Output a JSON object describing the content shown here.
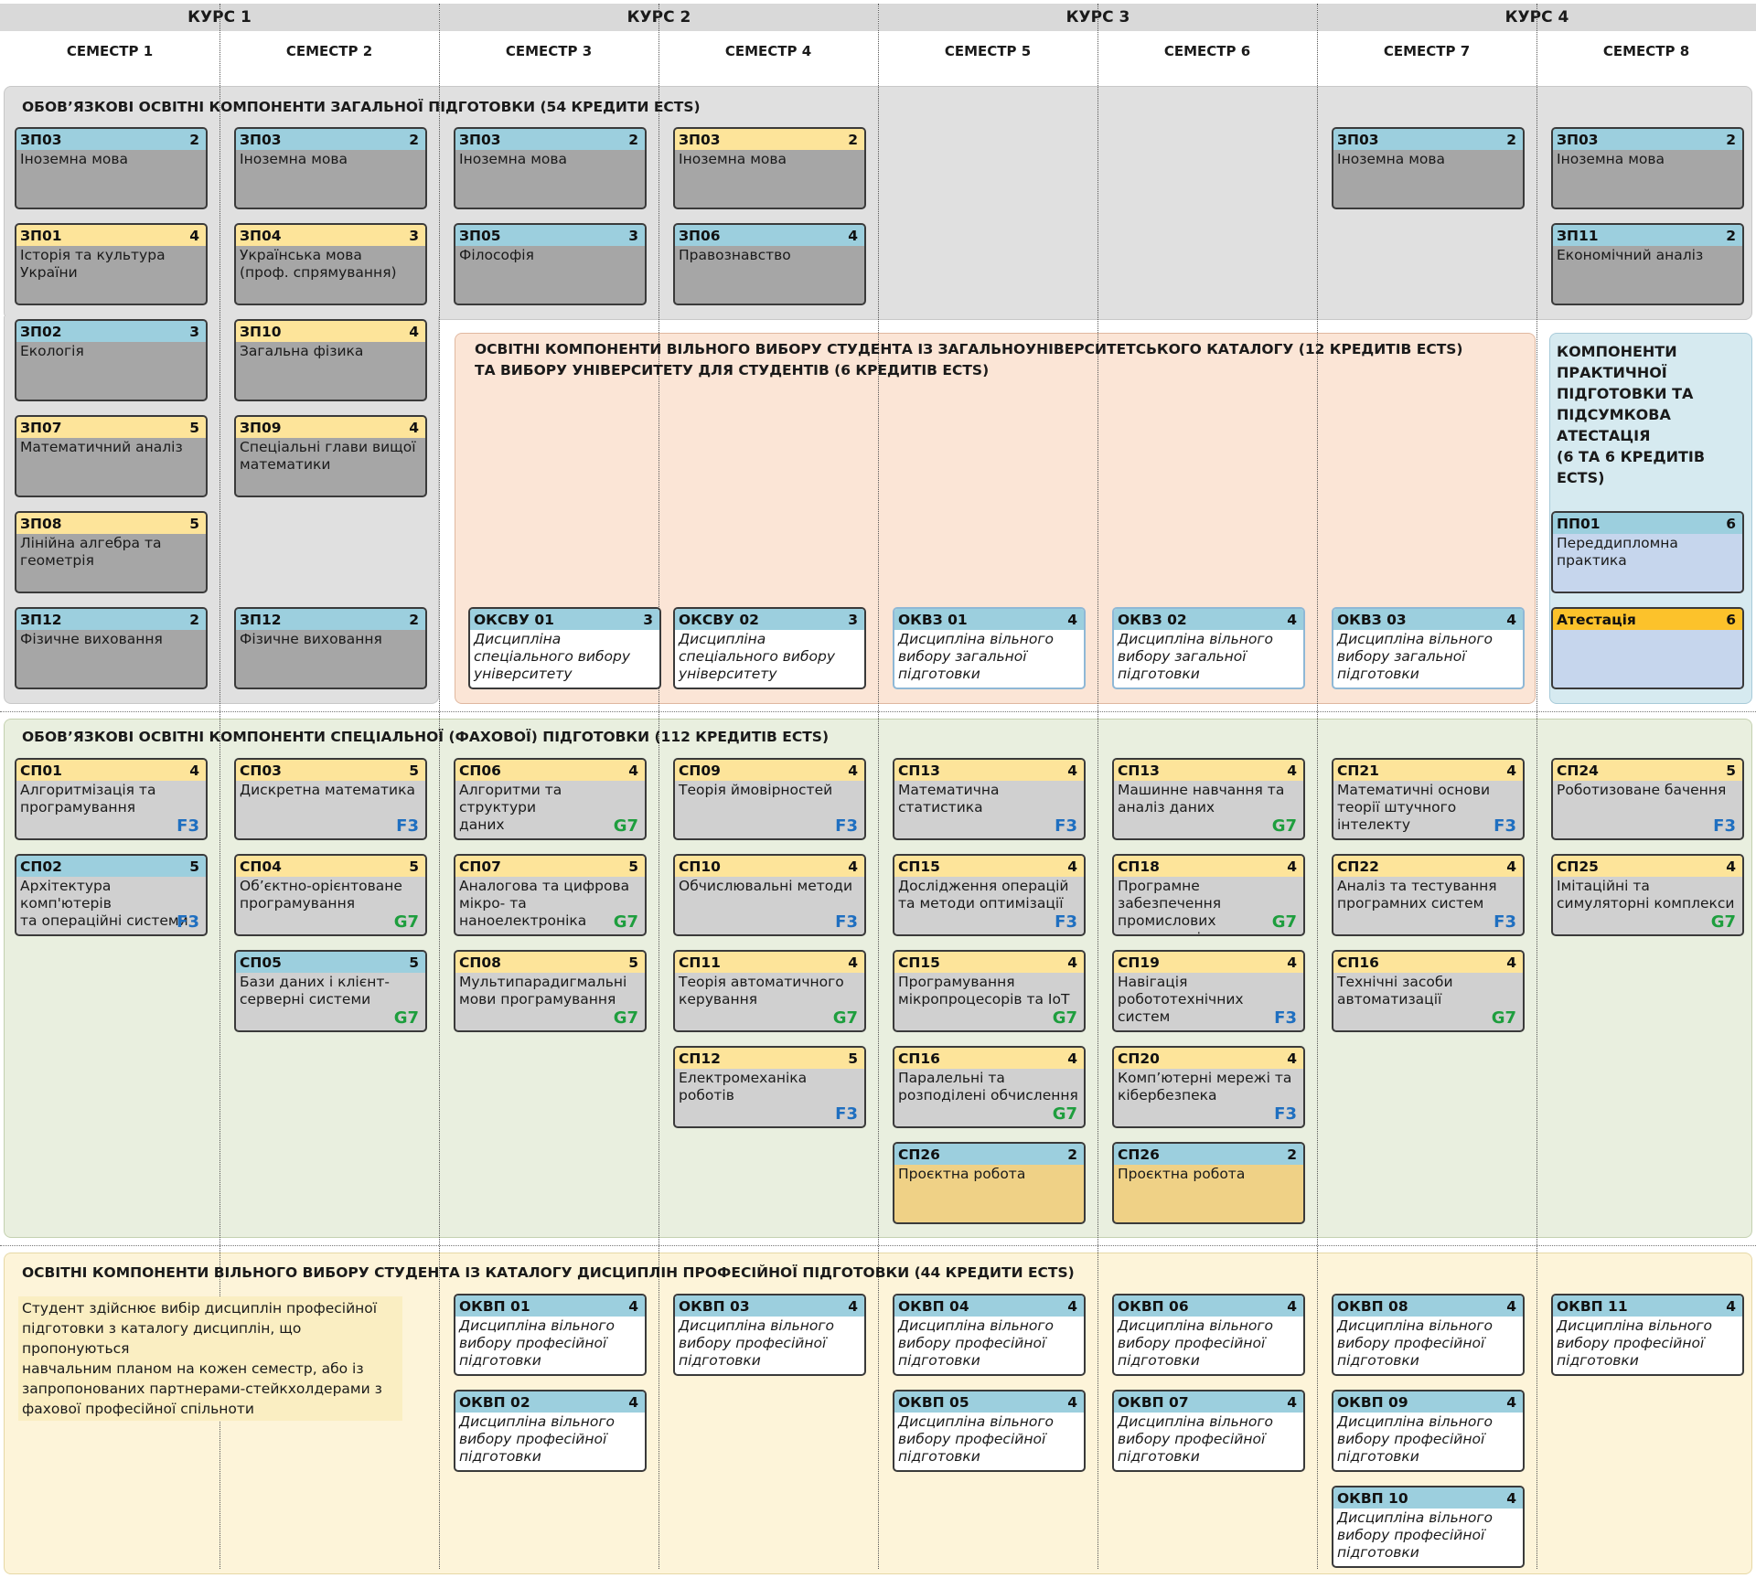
{
  "header": {
    "courses": [
      "КУРС 1",
      "КУРС 2",
      "КУРС 3",
      "КУРС 4"
    ],
    "semesters": [
      "СЕМЕСТР 1",
      "СЕМЕСТР 2",
      "СЕМЕСТР 3",
      "СЕМЕСТР 4",
      "СЕМЕСТР 5",
      "СЕМЕСТР 6",
      "СЕМЕСТР 7",
      "СЕМЕСТР 8"
    ]
  },
  "sections": {
    "general": {
      "title": "ОБОВ’ЯЗКОВІ ОСВІТНІ КОМПОНЕНТИ ЗАГАЛЬНОЇ ПІДГОТОВКИ (54 КРЕДИТИ ECTS)"
    },
    "free_choice": {
      "title_line1": "ОСВІТНІ КОМПОНЕНТИ ВІЛЬНОГО ВИБОРУ СТУДЕНТА ІЗ ЗАГАЛЬНОУНІВЕРСИТЕТСЬКОГО КАТАЛОГУ (12 КРЕДИТІВ ECTS)",
      "title_line2": "ТА ВИБОРУ УНІВЕРСИТЕТУ ДЛЯ СТУДЕНТІВ (6 КРЕДИТІВ ECTS)"
    },
    "practice": {
      "title_lines": [
        "КОМПОНЕНТИ",
        "ПРАКТИЧНОЇ",
        "ПІДГОТОВКИ ТА",
        "ПІДСУМКОВА АТЕСТАЦІЯ",
        "(6 ТА 6 КРЕДИТІВ ECTS)"
      ]
    },
    "special": {
      "title": "ОБОВ’ЯЗКОВІ ОСВІТНІ КОМПОНЕНТИ СПЕЦІАЛЬНОЇ (ФАХОВОЇ) ПІДГОТОВКИ (112 КРЕДИТІВ ECTS)"
    },
    "professional": {
      "title": "ОСВІТНІ КОМПОНЕНТИ ВІЛЬНОГО ВИБОРУ СТУДЕНТА ІЗ КАТАЛОГУ ДИСЦИПЛІН ПРОФЕСІЙНОЇ ПІДГОТОВКИ (44 КРЕДИТИ ECTS)",
      "note_lines": [
        "Студент здійснює вибір дисциплін професійної",
        "підготовки з каталогу дисциплін, що пропонуються",
        "навчальним планом на кожен семестр, або із",
        "запропонованих партнерами-стейкхолдерами з",
        "фахової професійної спільноти"
      ]
    }
  },
  "cards": [
    {
      "col": 0,
      "row": 0,
      "code": "ЗП03",
      "credits": "2",
      "lines": [
        "Іноземна мова"
      ],
      "header": "blue",
      "body": "dark"
    },
    {
      "col": 1,
      "row": 0,
      "code": "ЗП03",
      "credits": "2",
      "lines": [
        "Іноземна мова"
      ],
      "header": "blue",
      "body": "dark"
    },
    {
      "col": 2,
      "row": 0,
      "code": "ЗП03",
      "credits": "2",
      "lines": [
        "Іноземна мова"
      ],
      "header": "blue",
      "body": "dark"
    },
    {
      "col": 3,
      "row": 0,
      "code": "ЗП03",
      "credits": "2",
      "lines": [
        "Іноземна мова"
      ],
      "header": "yellow",
      "body": "dark"
    },
    {
      "col": 6,
      "row": 0,
      "code": "ЗП03",
      "credits": "2",
      "lines": [
        "Іноземна мова"
      ],
      "header": "blue",
      "body": "dark"
    },
    {
      "col": 7,
      "row": 0,
      "code": "ЗП03",
      "credits": "2",
      "lines": [
        "Іноземна мова"
      ],
      "header": "blue",
      "body": "dark"
    },
    {
      "col": 0,
      "row": 1,
      "code": "ЗП01",
      "credits": "4",
      "lines": [
        "Історія та культура",
        "України"
      ],
      "header": "yellow",
      "body": "dark"
    },
    {
      "col": 1,
      "row": 1,
      "code": "ЗП04",
      "credits": "3",
      "lines": [
        "Українська мова",
        "(проф. спрямування)"
      ],
      "header": "yellow",
      "body": "dark"
    },
    {
      "col": 2,
      "row": 1,
      "code": "ЗП05",
      "credits": "3",
      "lines": [
        "Філософія"
      ],
      "header": "blue",
      "body": "dark"
    },
    {
      "col": 3,
      "row": 1,
      "code": "ЗП06",
      "credits": "4",
      "lines": [
        "Правознавство"
      ],
      "header": "blue",
      "body": "dark"
    },
    {
      "col": 7,
      "row": 1,
      "code": "ЗП11",
      "credits": "2",
      "lines": [
        "Економічний аналіз"
      ],
      "header": "blue",
      "body": "dark"
    },
    {
      "col": 0,
      "row": 2,
      "code": "ЗП02",
      "credits": "3",
      "lines": [
        "Екологія"
      ],
      "header": "blue",
      "body": "dark"
    },
    {
      "col": 1,
      "row": 2,
      "code": "ЗП10",
      "credits": "4",
      "lines": [
        "Загальна фізика"
      ],
      "header": "yellow",
      "body": "dark"
    },
    {
      "col": 0,
      "row": 3,
      "code": "ЗП07",
      "credits": "5",
      "lines": [
        "Математичний аналіз"
      ],
      "header": "yellow",
      "body": "dark"
    },
    {
      "col": 1,
      "row": 3,
      "code": "ЗП09",
      "credits": "4",
      "lines": [
        "Спеціальні глави вищої",
        "математики"
      ],
      "header": "yellow",
      "body": "dark"
    },
    {
      "col": 0,
      "row": 4,
      "code": "ЗП08",
      "credits": "5",
      "lines": [
        "Лінійна алгебра та",
        "геометрія"
      ],
      "header": "yellow",
      "body": "dark"
    },
    {
      "col": 7,
      "row": 4,
      "code": "ПП01",
      "credits": "6",
      "lines": [
        "Переддипломна",
        "практика"
      ],
      "header": "blue",
      "body": "bluebody"
    },
    {
      "col": 0,
      "row": 5,
      "code": "ЗП12",
      "credits": "2",
      "lines": [
        "Фізичне виховання"
      ],
      "header": "blue",
      "body": "dark"
    },
    {
      "col": 1,
      "row": 5,
      "code": "ЗП12",
      "credits": "2",
      "lines": [
        "Фізичне виховання"
      ],
      "header": "blue",
      "body": "dark"
    },
    {
      "col": 2,
      "row": 5,
      "code": "ОКСВУ 01",
      "credits": "3",
      "lines": [
        "Дисципліна",
        "спеціального вибору",
        "університету"
      ],
      "header": "blue",
      "body": "white",
      "italic": true,
      "inset": true
    },
    {
      "col": 3,
      "row": 5,
      "code": "ОКСВУ 02",
      "credits": "3",
      "lines": [
        "Дисципліна",
        "спеціального вибору",
        "університету"
      ],
      "header": "blue",
      "body": "white",
      "italic": true
    },
    {
      "col": 4,
      "row": 5,
      "code": "ОКВЗ 01",
      "credits": "4",
      "lines": [
        "Дисципліна вільного",
        "вибору загальної",
        "підготовки"
      ],
      "header": "blue",
      "body": "white",
      "italic": true,
      "blueborder": true
    },
    {
      "col": 5,
      "row": 5,
      "code": "ОКВЗ 02",
      "credits": "4",
      "lines": [
        "Дисципліна вільного",
        "вибору загальної",
        "підготовки"
      ],
      "header": "blue",
      "body": "white",
      "italic": true,
      "blueborder": true
    },
    {
      "col": 6,
      "row": 5,
      "code": "ОКВЗ 03",
      "credits": "4",
      "lines": [
        "Дисципліна вільного",
        "вибору загальної",
        "підготовки"
      ],
      "header": "blue",
      "body": "white",
      "italic": true,
      "blueborder": true
    },
    {
      "col": 7,
      "row": 5,
      "code": "Атестація",
      "credits": "6",
      "lines": [],
      "header": "orange",
      "body": "bluebody"
    },
    {
      "col": 0,
      "row": 6,
      "code": "СП01",
      "credits": "4",
      "lines": [
        "Алгоритмізація та",
        "програмування"
      ],
      "header": "yellow",
      "body": "light",
      "tag": "F3"
    },
    {
      "col": 1,
      "row": 6,
      "code": "СП03",
      "credits": "5",
      "lines": [
        "Дискретна математика"
      ],
      "header": "yellow",
      "body": "light",
      "tag": "F3"
    },
    {
      "col": 2,
      "row": 6,
      "code": "СП06",
      "credits": "4",
      "lines": [
        "Алгоритми та структури",
        "даних"
      ],
      "header": "yellow",
      "body": "light",
      "tag": "G7"
    },
    {
      "col": 3,
      "row": 6,
      "code": "СП09",
      "credits": "4",
      "lines": [
        "Теорія ймовірностей"
      ],
      "header": "yellow",
      "body": "light",
      "tag": "F3"
    },
    {
      "col": 4,
      "row": 6,
      "code": "СП13",
      "credits": "4",
      "lines": [
        "Математична статистика"
      ],
      "header": "yellow",
      "body": "light",
      "tag": "F3"
    },
    {
      "col": 5,
      "row": 6,
      "code": "СП13",
      "credits": "4",
      "lines": [
        "Машинне навчання та",
        "аналіз даних"
      ],
      "header": "yellow",
      "body": "light",
      "tag": "G7"
    },
    {
      "col": 6,
      "row": 6,
      "code": "СП21",
      "credits": "4",
      "lines": [
        "Математичні основи",
        "теорії штучного",
        "інтелекту"
      ],
      "header": "yellow",
      "body": "light",
      "tag": "F3"
    },
    {
      "col": 7,
      "row": 6,
      "code": "СП24",
      "credits": "5",
      "lines": [
        "Роботизоване бачення"
      ],
      "header": "yellow",
      "body": "light",
      "tag": "F3"
    },
    {
      "col": 0,
      "row": 7,
      "code": "СП02",
      "credits": "5",
      "lines": [
        "Архітектура комп'ютерів",
        "та операційні системи"
      ],
      "header": "blue",
      "body": "light",
      "tag": "F3"
    },
    {
      "col": 1,
      "row": 7,
      "code": "СП04",
      "credits": "5",
      "lines": [
        "Об’єктно-орієнтоване",
        "програмування"
      ],
      "header": "yellow",
      "body": "light",
      "tag": "G7"
    },
    {
      "col": 2,
      "row": 7,
      "code": "СП07",
      "credits": "5",
      "lines": [
        "Аналогова та цифрова",
        "мікро- та",
        "наноелектроніка"
      ],
      "header": "yellow",
      "body": "light",
      "tag": "G7"
    },
    {
      "col": 3,
      "row": 7,
      "code": "СП10",
      "credits": "4",
      "lines": [
        "Обчислювальні методи"
      ],
      "header": "yellow",
      "body": "light",
      "tag": "F3"
    },
    {
      "col": 4,
      "row": 7,
      "code": "СП15",
      "credits": "4",
      "lines": [
        "Дослідження операцій",
        "та методи оптимізації"
      ],
      "header": "yellow",
      "body": "light",
      "tag": "F3"
    },
    {
      "col": 5,
      "row": 7,
      "code": "СП18",
      "credits": "4",
      "lines": [
        "Програмне забезпечення",
        "промислових контролерів"
      ],
      "header": "yellow",
      "body": "light",
      "tag": "G7"
    },
    {
      "col": 6,
      "row": 7,
      "code": "СП22",
      "credits": "4",
      "lines": [
        "Аналіз та тестування",
        "програмних систем"
      ],
      "header": "yellow",
      "body": "light",
      "tag": "F3"
    },
    {
      "col": 7,
      "row": 7,
      "code": "СП25",
      "credits": "4",
      "lines": [
        "Імітаційні та",
        "симуляторні комплекси"
      ],
      "header": "yellow",
      "body": "light",
      "tag": "G7"
    },
    {
      "col": 1,
      "row": 8,
      "code": "СП05",
      "credits": "5",
      "lines": [
        "Бази даних і клієнт-",
        "серверні системи"
      ],
      "header": "blue",
      "body": "light",
      "tag": "G7"
    },
    {
      "col": 2,
      "row": 8,
      "code": "СП08",
      "credits": "5",
      "lines": [
        "Мультипарадигмальні",
        "мови програмування"
      ],
      "header": "yellow",
      "body": "light",
      "tag": "G7"
    },
    {
      "col": 3,
      "row": 8,
      "code": "СП11",
      "credits": "4",
      "lines": [
        "Теорія автоматичного",
        "керування"
      ],
      "header": "yellow",
      "body": "light",
      "tag": "G7"
    },
    {
      "col": 4,
      "row": 8,
      "code": "СП15",
      "credits": "4",
      "lines": [
        "Програмування",
        "мікропроцесорів та IoT"
      ],
      "header": "yellow",
      "body": "light",
      "tag": "G7"
    },
    {
      "col": 5,
      "row": 8,
      "code": "СП19",
      "credits": "4",
      "lines": [
        "Навігація",
        "робототехнічних систем"
      ],
      "header": "yellow",
      "body": "light",
      "tag": "F3"
    },
    {
      "col": 6,
      "row": 8,
      "code": "СП16",
      "credits": "4",
      "lines": [
        "Технічні засоби",
        "автоматизації"
      ],
      "header": "yellow",
      "body": "light",
      "tag": "G7"
    },
    {
      "col": 3,
      "row": 9,
      "code": "СП12",
      "credits": "5",
      "lines": [
        "Електромеханіка",
        "роботів"
      ],
      "header": "yellow",
      "body": "light",
      "tag": "F3"
    },
    {
      "col": 4,
      "row": 9,
      "code": "СП16",
      "credits": "4",
      "lines": [
        "Паралельні та",
        "розподілені обчислення"
      ],
      "header": "yellow",
      "body": "light",
      "tag": "G7"
    },
    {
      "col": 5,
      "row": 9,
      "code": "СП20",
      "credits": "4",
      "lines": [
        "Комп’ютерні мережі та",
        "кібербезпека"
      ],
      "header": "yellow",
      "body": "light",
      "tag": "F3"
    },
    {
      "col": 4,
      "row": 10,
      "code": "СП26",
      "credits": "2",
      "lines": [
        "Проєктна робота"
      ],
      "header": "blue",
      "body": "yellowbody"
    },
    {
      "col": 5,
      "row": 10,
      "code": "СП26",
      "credits": "2",
      "lines": [
        "Проєктна робота"
      ],
      "header": "blue",
      "body": "yellowbody"
    },
    {
      "col": 2,
      "row": 11,
      "code": "ОКВП 01",
      "credits": "4",
      "lines": [
        "Дисципліна вільного",
        "вибору професійної",
        "підготовки"
      ],
      "header": "blue",
      "body": "white",
      "italic": true
    },
    {
      "col": 3,
      "row": 11,
      "code": "ОКВП 03",
      "credits": "4",
      "lines": [
        "Дисципліна вільного",
        "вибору професійної",
        "підготовки"
      ],
      "header": "blue",
      "body": "white",
      "italic": true
    },
    {
      "col": 4,
      "row": 11,
      "code": "ОКВП 04",
      "credits": "4",
      "lines": [
        "Дисципліна вільного",
        "вибору професійної",
        "підготовки"
      ],
      "header": "blue",
      "body": "white",
      "italic": true
    },
    {
      "col": 5,
      "row": 11,
      "code": "ОКВП 06",
      "credits": "4",
      "lines": [
        "Дисципліна вільного",
        "вибору професійної",
        "підготовки"
      ],
      "header": "blue",
      "body": "white",
      "italic": true
    },
    {
      "col": 6,
      "row": 11,
      "code": "ОКВП 08",
      "credits": "4",
      "lines": [
        "Дисципліна вільного",
        "вибору професійної",
        "підготовки"
      ],
      "header": "blue",
      "body": "white",
      "italic": true
    },
    {
      "col": 7,
      "row": 11,
      "code": "ОКВП 11",
      "credits": "4",
      "lines": [
        "Дисципліна вільного",
        "вибору професійної",
        "підготовки"
      ],
      "header": "blue",
      "body": "white",
      "italic": true
    },
    {
      "col": 2,
      "row": 12,
      "code": "ОКВП 02",
      "credits": "4",
      "lines": [
        "Дисципліна вільного",
        "вибору професійної",
        "підготовки"
      ],
      "header": "blue",
      "body": "white",
      "italic": true
    },
    {
      "col": 4,
      "row": 12,
      "code": "ОКВП 05",
      "credits": "4",
      "lines": [
        "Дисципліна вільного",
        "вибору професійної",
        "підготовки"
      ],
      "header": "blue",
      "body": "white",
      "italic": true
    },
    {
      "col": 5,
      "row": 12,
      "code": "ОКВП 07",
      "credits": "4",
      "lines": [
        "Дисципліна вільного",
        "вибору професійної",
        "підготовки"
      ],
      "header": "blue",
      "body": "white",
      "italic": true
    },
    {
      "col": 6,
      "row": 12,
      "code": "ОКВП 09",
      "credits": "4",
      "lines": [
        "Дисципліна вільного",
        "вибору професійної",
        "підготовки"
      ],
      "header": "blue",
      "body": "white",
      "italic": true
    },
    {
      "col": 6,
      "row": 13,
      "code": "ОКВП 10",
      "credits": "4",
      "lines": [
        "Дисципліна вільного",
        "вибору професійної",
        "підготовки"
      ],
      "header": "blue",
      "body": "white",
      "italic": true
    }
  ]
}
